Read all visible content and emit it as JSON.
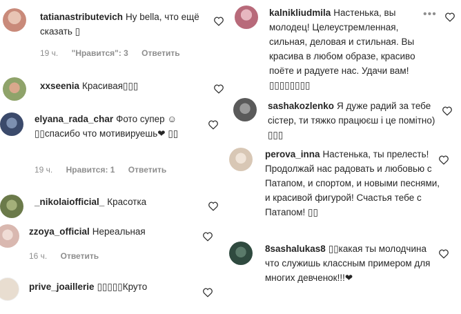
{
  "left_column": [
    {
      "username": "tatianastributevich",
      "text": "Ну bella, что ещё сказать ▯",
      "time": "19 ч.",
      "likes": "\"Нравится\": 3",
      "reply": "Ответить",
      "avatar_color": "#c98a7a"
    },
    {
      "username": "xxseenia",
      "text": "Красивая▯▯▯",
      "avatar_color": "#8fa36a"
    },
    {
      "username": "elyana_rada_char",
      "text": "Фото супер ☺ ▯▯спасибо что мотивируешь❤ ▯▯",
      "time": "19 ч.",
      "likes": "Нравится: 1",
      "reply": "Ответить",
      "avatar_color": "#3b4a6b"
    },
    {
      "username": "_nikolaiofficial_",
      "text": "Красотка",
      "avatar_color": "#6b7a4a"
    },
    {
      "username": "zzoya_official",
      "text": "Нереальная",
      "time": "16 ч.",
      "reply": "Ответить",
      "avatar_color": "#d9b8b0"
    },
    {
      "username": "prive_joaillerie",
      "text": "▯▯▯▯▯Круто",
      "avatar_color": "#e8ddd0"
    }
  ],
  "right_column": [
    {
      "username": "kalnikliudmila",
      "text": "Настенька, вы молодец! Целеустремленная, сильная, деловая и стильная. Вы красива в любом образе, красиво поёте и радуете нас. Удачи вам! ▯▯▯▯▯▯▯▯",
      "avatar_color": "#b86a7a"
    },
    {
      "username": "sashakozlenko",
      "text": "Я дуже радий за тебе сістер, ти тяжко працюєш і це помітно) ▯▯▯",
      "avatar_color": "#5a5a5a"
    },
    {
      "username": "perova_inna",
      "text": "Настенька, ты прелесть! Продолжай нас радовать и любовью с Патапом, и спортом, и новыми песнями, и красивой фигурой! Счастья тебе с Патапом! ▯▯",
      "avatar_color": "#d8c7b5"
    },
    {
      "username": "8sashalukas8",
      "text": "▯▯какая ты молодчина что служишь классным примером для многих девченок!!!❤",
      "avatar_color": "#2f4a3f"
    }
  ],
  "icons": {
    "heart": "heart-icon",
    "more": "more-options-icon"
  },
  "colors": {
    "text": "#262626",
    "meta": "#8e8e8e",
    "background": "#ffffff"
  }
}
